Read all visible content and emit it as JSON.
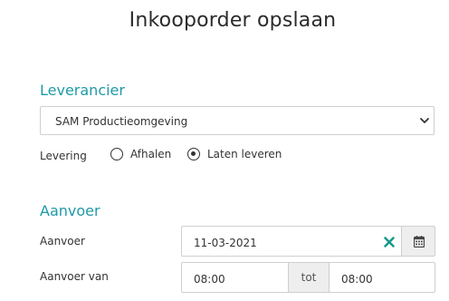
{
  "dialog": {
    "title": "Inkooporder opslaan"
  },
  "leverancier": {
    "heading": "Leverancier",
    "selected": "SAM Productieomgeving",
    "chevron_icon": "chevron-down-icon"
  },
  "levering": {
    "label": "Levering",
    "options": [
      {
        "label": "Afhalen",
        "checked": false
      },
      {
        "label": "Laten leveren",
        "checked": true
      }
    ]
  },
  "aanvoer": {
    "heading": "Aanvoer",
    "date_label": "Aanvoer",
    "date_value": "11-03-2021",
    "clear_icon": "clear-icon",
    "clear_color": "#1a9a8a",
    "calendar_icon": "calendar-icon",
    "time_label": "Aanvoer van",
    "time_from": "08:00",
    "between_label": "tot",
    "time_to": "08:00"
  }
}
